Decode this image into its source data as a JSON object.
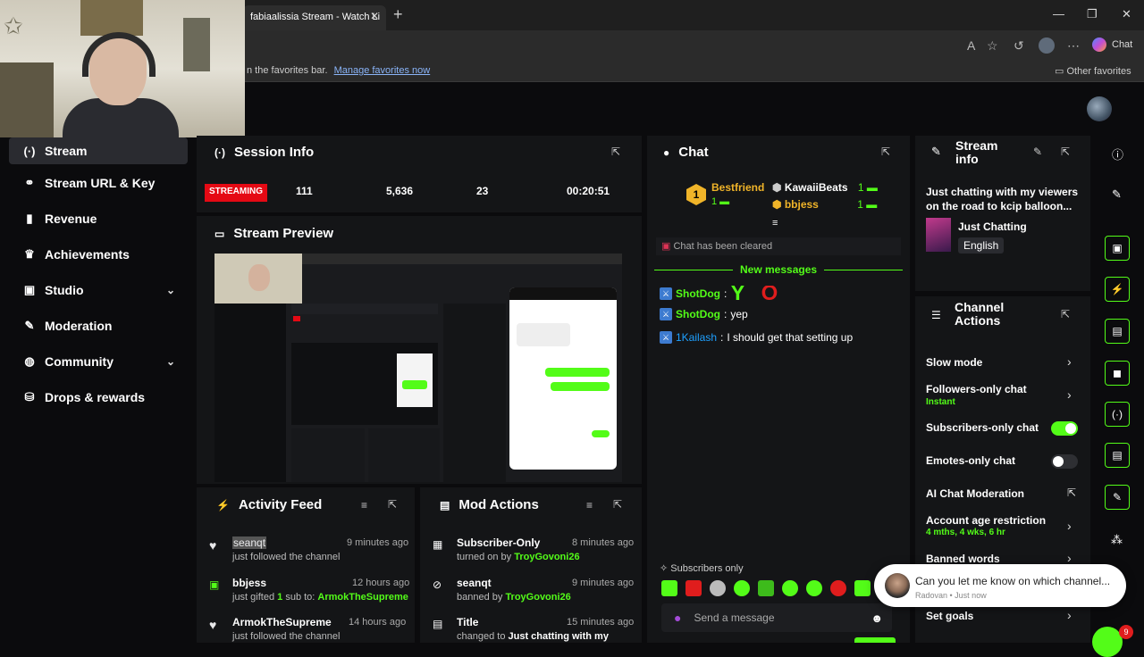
{
  "browser": {
    "tab_title": "fabiaalissia Stream - Watch Li",
    "chat_button": "Chat",
    "favorites_text": "n the favorites bar.",
    "favorites_link": "Manage favorites now",
    "other_favorites": "Other favorites"
  },
  "nav": {
    "items": [
      {
        "label": "Stream",
        "icon": "broadcast-icon"
      },
      {
        "label": "Stream URL & Key",
        "icon": "link-icon"
      },
      {
        "label": "Revenue",
        "icon": "chart-icon"
      },
      {
        "label": "Achievements",
        "icon": "trophy-icon"
      },
      {
        "label": "Studio",
        "icon": "camera-icon"
      },
      {
        "label": "Moderation",
        "icon": "wrench-icon"
      },
      {
        "label": "Community",
        "icon": "globe-icon"
      },
      {
        "label": "Drops & rewards",
        "icon": "gift-icon"
      }
    ]
  },
  "session": {
    "title": "Session Info",
    "status": "STREAMING",
    "viewers": "111",
    "followers": "5,636",
    "subs": "23",
    "uptime": "00:20:51"
  },
  "preview": {
    "title": "Stream Preview"
  },
  "activity": {
    "title": "Activity Feed",
    "items": [
      {
        "name": "seanqt",
        "time": "9 minutes ago",
        "pre": "just followed the channel",
        "highlight": "",
        "post": ""
      },
      {
        "name": "bbjess",
        "time": "12 hours ago",
        "pre": "just gifted ",
        "highlight": "1",
        "post": " sub to: ",
        "target": "ArmokTheSupreme"
      },
      {
        "name": "ArmokTheSupreme",
        "time": "14 hours ago",
        "pre": "just followed the channel",
        "highlight": "",
        "post": ""
      }
    ]
  },
  "mod": {
    "title": "Mod Actions",
    "items": [
      {
        "name": "Subscriber-Only",
        "time": "8 minutes ago",
        "pre": "turned on by ",
        "target": "TroyGovoni26"
      },
      {
        "name": "seanqt",
        "time": "9 minutes ago",
        "pre": "banned by ",
        "target": "TroyGovoni26"
      },
      {
        "name": "Title",
        "time": "15 minutes ago",
        "pre": "changed to ",
        "target": "Just chatting with my"
      }
    ]
  },
  "chat": {
    "title": "Chat",
    "leaders": [
      {
        "rank": "1",
        "name": "Bestfriend",
        "count": "1"
      },
      {
        "name": "KawaiiBeats",
        "count": "1"
      },
      {
        "name": "bbjess",
        "count": "1"
      }
    ],
    "cleared": "Chat has been cleared",
    "new_messages": "New messages",
    "messages": [
      {
        "user": "ShotDog",
        "text": "Y O"
      },
      {
        "user": "ShotDog",
        "text": "yep"
      },
      {
        "user": "1Kailash",
        "text": "I should get that setting up"
      }
    ],
    "subs_only": "Subscribers only",
    "input_placeholder": "Send a message"
  },
  "stream_info": {
    "title": "Stream info",
    "description": "Just chatting with my viewers on the road to kcip balloon...",
    "category": "Just Chatting",
    "language": "English"
  },
  "channel_actions": {
    "title": "Channel Actions",
    "slow_mode": "Slow mode",
    "followers_only": "Followers-only chat",
    "followers_only_value": "Instant",
    "subscribers_only": "Subscribers-only chat",
    "emotes_only": "Emotes-only chat",
    "ai_moderation": "AI Chat Moderation",
    "age_restriction": "Account age restriction",
    "age_restriction_value": "4 mths, 4 wks, 6 hr",
    "banned_words": "Banned words",
    "set_goals": "Set goals"
  },
  "toast": {
    "message": "Can you let me know on which channel...",
    "meta": "Radovan • Just now",
    "badge_count": "9"
  },
  "colors": {
    "accent": "#53fc18",
    "live": "#e50914",
    "panel": "#141517"
  }
}
